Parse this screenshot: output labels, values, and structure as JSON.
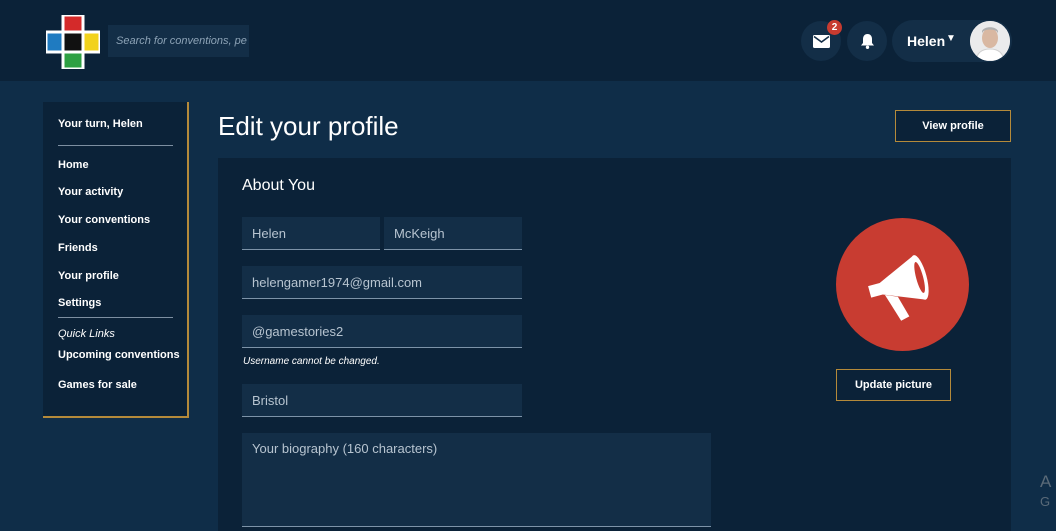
{
  "header": {
    "search_placeholder": "Search for conventions, pe",
    "mail_badge": "2",
    "user_name": "Helen"
  },
  "sidebar": {
    "greeting": "Your turn, Helen",
    "items": [
      "Home",
      "Your activity",
      "Your conventions",
      "Friends",
      "Your profile",
      "Settings"
    ],
    "quick_links_label": "Quick Links",
    "quick_links": [
      "Upcoming conventions",
      "Games for sale"
    ]
  },
  "main": {
    "title": "Edit your profile",
    "view_profile_label": "View profile",
    "section_title": "About You",
    "first_name": "Helen",
    "last_name": "McKeigh",
    "email": "helengamer1974@gmail.com",
    "username": "@gamestories2",
    "username_note": "Username cannot be changed.",
    "city": "Bristol",
    "bio_placeholder": "Your biography (160 characters)",
    "update_picture_label": "Update picture"
  },
  "watermark": {
    "line1": "A",
    "line2": "G"
  },
  "colors": {
    "page_bg": "#0f2d48",
    "panel_bg": "#0b2238",
    "field_bg": "#132e47",
    "accent_border": "#b58a3a",
    "profile_red": "#c83c31",
    "badge_red": "#c73b30"
  },
  "icons": [
    "logo-cross",
    "mail-icon",
    "bell-icon",
    "caret-down-icon",
    "megaphone-icon",
    "avatar-photo"
  ]
}
